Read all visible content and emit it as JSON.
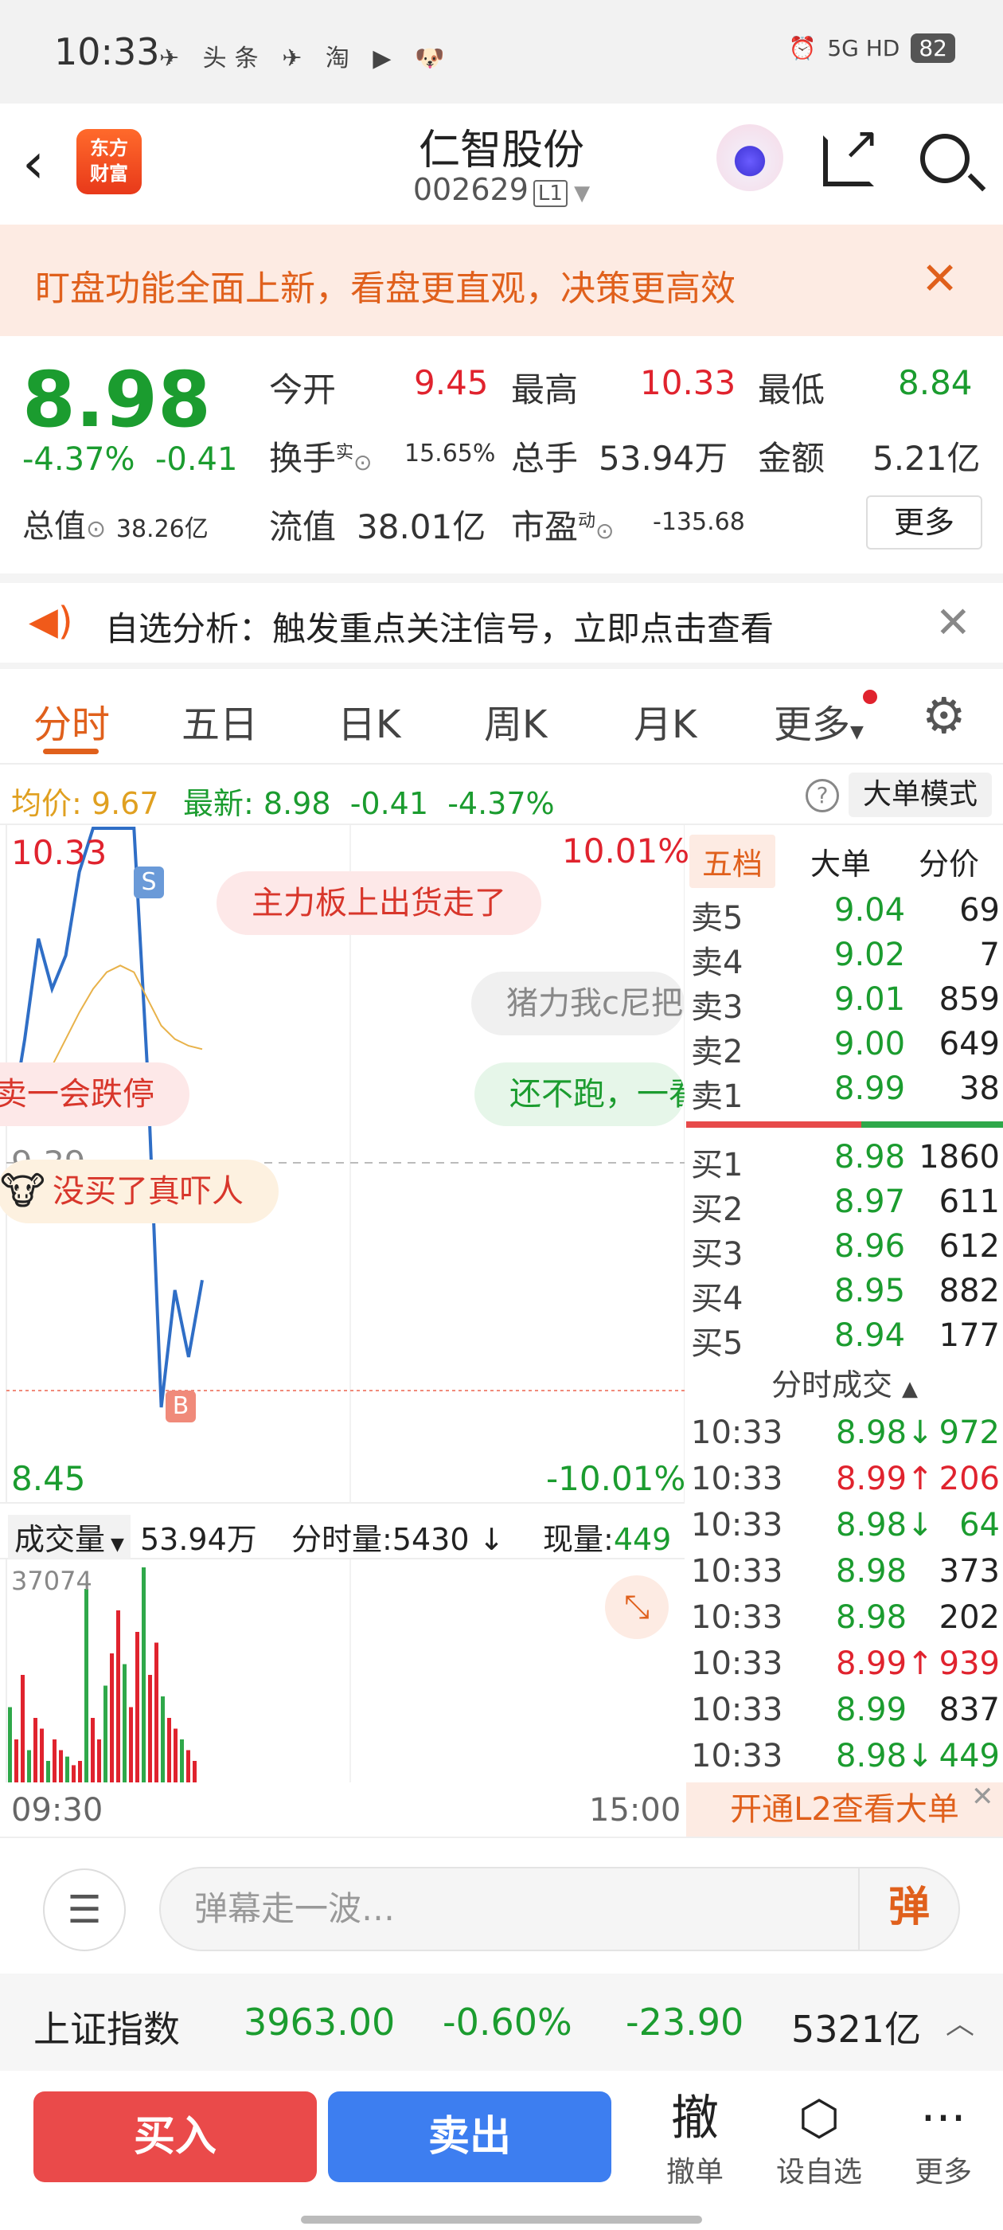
{
  "status": {
    "time": "10:33",
    "icons": "✈ 头条 ✈ 淘 ▶ 🐶",
    "network": "5G HD",
    "battery": "82"
  },
  "header": {
    "title": "仁智股份",
    "code": "002629",
    "level": "L1",
    "logo": "东方\n财富"
  },
  "banner": {
    "text": "盯盘功能全面上新，看盘更直观，决策更高效"
  },
  "quote": {
    "price": "8.98",
    "change_pct": "-4.37%",
    "change": "-0.41",
    "zongzhi_label": "总值",
    "zongzhi": "38.26亿",
    "open_label": "今开",
    "open": "9.45",
    "high_label": "最高",
    "high": "10.33",
    "low_label": "最低",
    "low": "8.84",
    "turnover_label": "换手",
    "turnover_sup": "实",
    "turnover": "15.65%",
    "volume_label": "总手",
    "volume": "53.94万",
    "amount_label": "金额",
    "amount": "5.21亿",
    "float_label": "流值",
    "float": "38.01亿",
    "pe_label": "市盈",
    "pe_sup": "动",
    "pe": "-135.68",
    "more": "更多"
  },
  "news": {
    "text": "自选分析：触发重点关注信号，立即点击查看"
  },
  "tabs": [
    "分时",
    "五日",
    "日K",
    "周K",
    "月K",
    "更多"
  ],
  "avgline": {
    "avg_label": "均价:",
    "avg": "9.67",
    "latest_label": "最新:",
    "latest": "8.98",
    "chg": "-0.41",
    "pct": "-4.37%",
    "mode": "大单模式"
  },
  "chart": {
    "top_price": "10.33",
    "top_pct": "10.01%",
    "mid_price": "9.39",
    "bottom_price": "8.45",
    "bottom_pct": "-10.01%",
    "sell_marker": "S",
    "buy_marker": "B",
    "bubbles": [
      "主力板上出货走了",
      "猪力我c尼把",
      "卖一会跌停",
      "还不跑，一看",
      "没买了真吓人"
    ]
  },
  "chart_data": {
    "type": "line",
    "title": "",
    "xlabel": "",
    "ylabel": "",
    "x_ticks": [
      "09:30",
      "15:00"
    ],
    "ylim": [
      8.45,
      10.33
    ],
    "series": [
      {
        "values": [
          9.45,
          9.7,
          10.0,
          9.85,
          9.95,
          10.2,
          10.33,
          10.33,
          10.33,
          10.33,
          9.6,
          8.6,
          8.95,
          8.75,
          8.98
        ]
      },
      {
        "values": [
          9.45,
          9.48,
          9.55,
          9.62,
          9.7,
          9.78,
          9.85,
          9.9,
          9.92,
          9.9,
          9.82,
          9.74,
          9.7,
          9.68,
          9.67
        ]
      }
    ],
    "volume": {
      "max_label": "37074",
      "bars": [
        0.35,
        0.2,
        0.5,
        0.15,
        0.3,
        0.25,
        0.1,
        0.2,
        0.15,
        0.12,
        0.08,
        0.1,
        0.9,
        0.3,
        0.2,
        0.45,
        0.6,
        0.8,
        0.55,
        0.35,
        0.7,
        1.0,
        0.5,
        0.65,
        0.4,
        0.3,
        0.25,
        0.2,
        0.15,
        0.1
      ]
    }
  },
  "volrow": {
    "label": "成交量",
    "total": "53.94万",
    "fenshi": "分时量:5430",
    "xianliang_label": "现量:",
    "xianliang": "449"
  },
  "time_start": "09:30",
  "time_end": "15:00",
  "book": {
    "tabs": [
      "五档",
      "大单",
      "分价"
    ],
    "asks": [
      {
        "k": "卖5",
        "p": "9.04",
        "v": "69"
      },
      {
        "k": "卖4",
        "p": "9.02",
        "v": "7"
      },
      {
        "k": "卖3",
        "p": "9.01",
        "v": "859"
      },
      {
        "k": "卖2",
        "p": "9.00",
        "v": "649"
      },
      {
        "k": "卖1",
        "p": "8.99",
        "v": "38"
      }
    ],
    "bids": [
      {
        "k": "买1",
        "p": "8.98",
        "v": "1860"
      },
      {
        "k": "买2",
        "p": "8.97",
        "v": "611"
      },
      {
        "k": "买3",
        "p": "8.96",
        "v": "612"
      },
      {
        "k": "买4",
        "p": "8.95",
        "v": "882"
      },
      {
        "k": "买5",
        "p": "8.94",
        "v": "177"
      }
    ],
    "trades_title": "分时成交",
    "trades": [
      {
        "t": "10:33",
        "p": "8.98↓",
        "v": "972",
        "dir": "down"
      },
      {
        "t": "10:33",
        "p": "8.99↑",
        "v": "206",
        "dir": "up"
      },
      {
        "t": "10:33",
        "p": "8.98↓",
        "v": "64",
        "dir": "down"
      },
      {
        "t": "10:33",
        "p": "8.98",
        "v": "373",
        "dir": "flat"
      },
      {
        "t": "10:33",
        "p": "8.98",
        "v": "202",
        "dir": "flat"
      },
      {
        "t": "10:33",
        "p": "8.99↑",
        "v": "939",
        "dir": "up"
      },
      {
        "t": "10:33",
        "p": "8.99",
        "v": "837",
        "dir": "flat"
      },
      {
        "t": "10:33",
        "p": "8.98↓",
        "v": "449",
        "dir": "down"
      }
    ],
    "l2": "开通L2查看大单"
  },
  "comment": {
    "placeholder": "弹幕走一波…",
    "dan": "弹"
  },
  "index": {
    "name": "上证指数",
    "value": "3963.00",
    "pct": "-0.60%",
    "chg": "-23.90",
    "amount": "5321亿"
  },
  "actions": {
    "buy": "买入",
    "sell": "卖出",
    "cancel": "撤单",
    "cancel_icon": "撤",
    "watch": "设自选",
    "more": "更多"
  }
}
